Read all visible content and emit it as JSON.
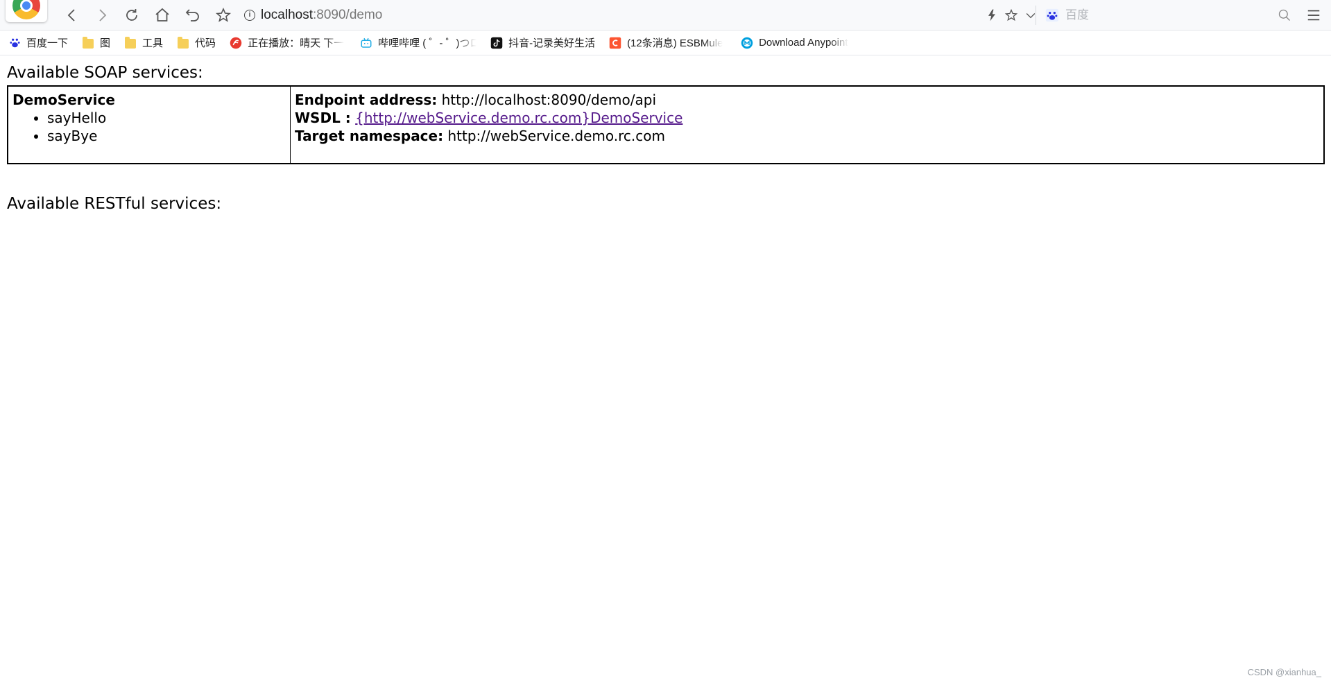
{
  "browser": {
    "url_host": "localhost",
    "url_path": ":8090/demo",
    "search_placeholder": "百度"
  },
  "bookmarks": [
    {
      "icon": "baidu-paw-icon",
      "label": "百度一下"
    },
    {
      "icon": "folder-icon",
      "label": "图"
    },
    {
      "icon": "folder-icon",
      "label": "工具"
    },
    {
      "icon": "folder-icon",
      "label": "代码"
    },
    {
      "icon": "music-player-icon",
      "label": "正在播放：晴天 下一"
    },
    {
      "icon": "bilibili-icon",
      "label": "哔哩哔哩 ( ゜- ゜)つロ"
    },
    {
      "icon": "douyin-icon",
      "label": "抖音-记录美好生活"
    },
    {
      "icon": "csdn-icon",
      "label": "(12条消息) ESBMule"
    },
    {
      "icon": "mulesoft-icon",
      "label": "Download Anypoint"
    }
  ],
  "page": {
    "soap_heading": "Available SOAP services:",
    "service": {
      "name": "DemoService",
      "operations": [
        "sayHello",
        "sayBye"
      ],
      "endpoint_label": "Endpoint address:",
      "endpoint_value": "http://localhost:8090/demo/api",
      "wsdl_label": "WSDL :",
      "wsdl_link": "{http://webService.demo.rc.com}DemoService",
      "namespace_label": "Target namespace:",
      "namespace_value": "http://webService.demo.rc.com"
    },
    "rest_heading": "Available RESTful services:"
  },
  "watermark": "CSDN @xianhua_",
  "colors": {
    "link": "#551a8b",
    "toolbar_bg": "#f8f9fb",
    "folder": "#f6cf59"
  }
}
